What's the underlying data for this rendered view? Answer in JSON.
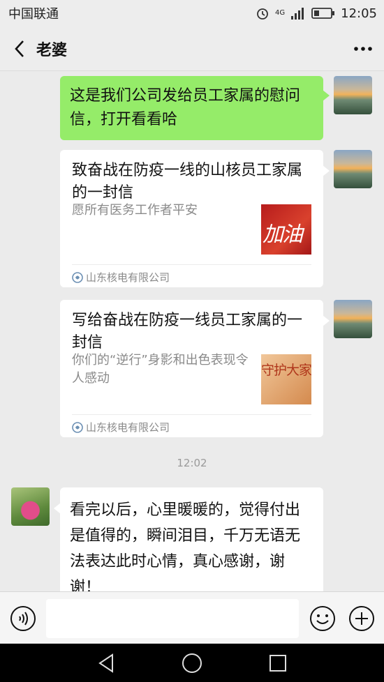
{
  "status_bar": {
    "carrier": "中国联通",
    "network": "4G",
    "time": "12:05"
  },
  "header": {
    "title": "老婆"
  },
  "messages": {
    "m1": {
      "text": "这是我们公司发给员工家属的慰问信，打开看看哈"
    },
    "card1": {
      "title": "致奋战在防疫一线的山核员工家属的一封信",
      "desc": "愿所有医务工作者平安",
      "thumb_text": "加油",
      "source": "山东核电有限公司"
    },
    "card2": {
      "title": "写给奋战在防疫一线员工家属的一封信",
      "desc": "你们的“逆行”身影和出色表现令人感动",
      "thumb_text": "守护大家",
      "source": "山东核电有限公司"
    },
    "timestamp": "12:02",
    "reply": {
      "text": "看完以后，心里暖暖的，觉得付出是值得的，瞬间泪目，千万无语无法表达此时心情，真心感谢，谢谢！"
    }
  },
  "icons": {
    "back": "chevron-left-icon",
    "more": "more-dots-icon",
    "voice": "voice-icon",
    "emoji": "emoji-icon",
    "plus": "plus-icon",
    "source": "company-logo-icon",
    "nav_back": "nav-back-icon",
    "nav_home": "nav-home-icon",
    "nav_recent": "nav-recent-icon"
  },
  "colors": {
    "sent_bubble": "#95ec69",
    "received_bubble": "#ffffff",
    "background": "#ebebeb"
  }
}
